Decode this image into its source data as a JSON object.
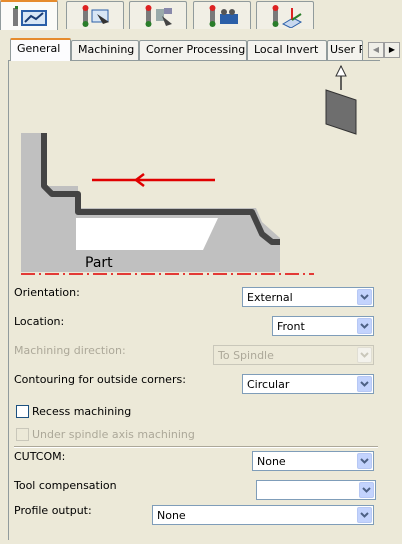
{
  "icon_tabs": [
    {
      "icon": "general-properties-icon",
      "active": true
    },
    {
      "icon": "machining-tool-icon",
      "active": false
    },
    {
      "icon": "tool-assembly-icon",
      "active": false
    },
    {
      "icon": "feeds-speeds-icon",
      "active": false
    },
    {
      "icon": "macro-axis-icon",
      "active": false
    }
  ],
  "tabs": [
    "General",
    "Machining",
    "Corner Processing",
    "Local Invert",
    "User P"
  ],
  "active_tab": "General",
  "diagram": {
    "part_label": "Part"
  },
  "fields": {
    "orientation": {
      "label": "Orientation:",
      "value": "External"
    },
    "location": {
      "label": "Location:",
      "value": "Front"
    },
    "machining_direction": {
      "label": "Machining direction:",
      "value": "To Spindle",
      "enabled": false
    },
    "contouring": {
      "label": "Contouring for outside corners:",
      "value": "Circular"
    },
    "recess": {
      "label": "Recess machining",
      "checked": false
    },
    "under_spindle": {
      "label": "Under spindle axis machining",
      "checked": false,
      "enabled": false
    },
    "cutcom": {
      "label": "CUTCOM:",
      "value": "None"
    },
    "tool_compensation": {
      "label": "Tool compensation",
      "value": ""
    },
    "profile_output": {
      "label": "Profile output:",
      "value": "None"
    }
  },
  "colors": {
    "arrow": "#e00000",
    "axis_line": "#e00000",
    "part_fill": "#c0c0c0",
    "active_tab_accent": "#e68b2c"
  }
}
